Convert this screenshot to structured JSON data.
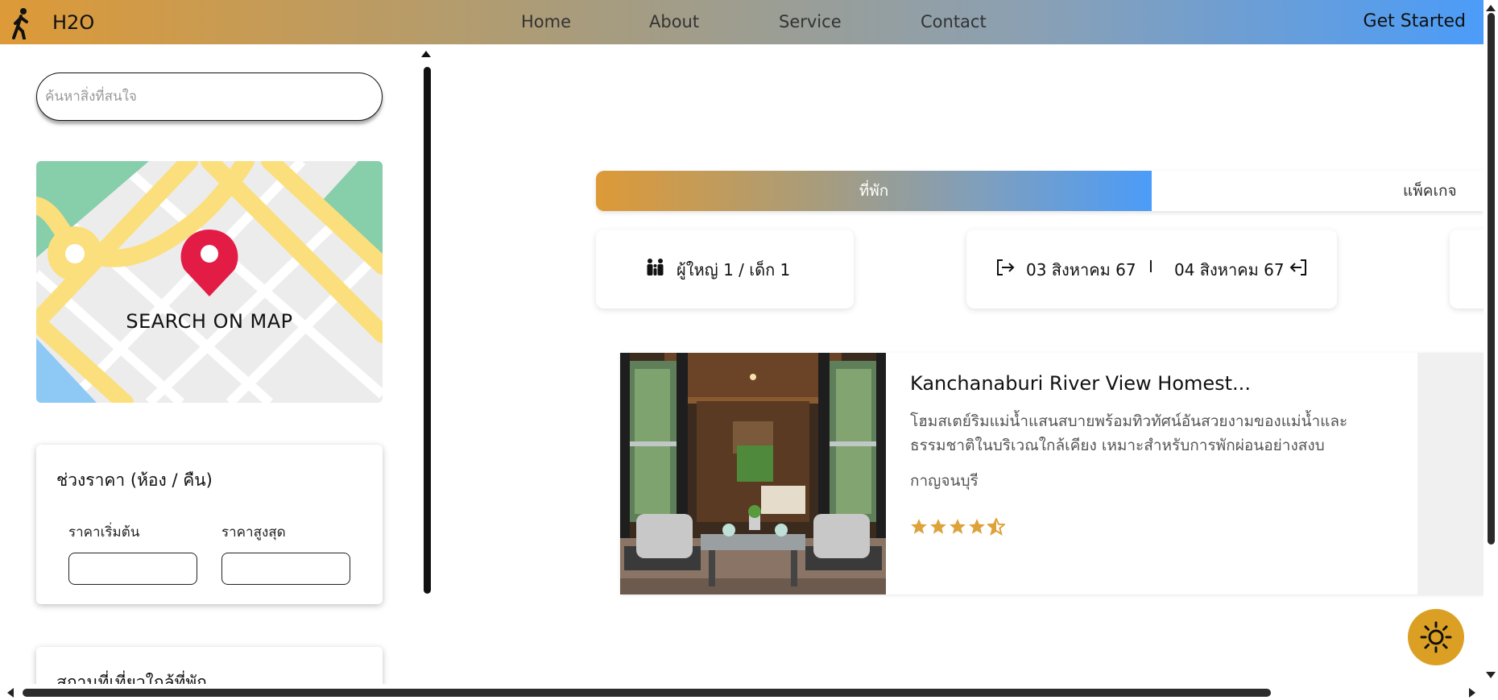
{
  "header": {
    "brand": "H2O",
    "nav": [
      "Home",
      "About",
      "Service",
      "Contact"
    ],
    "cta_label": "Get Started",
    "logo_icon": "walking-person-icon",
    "gradient_start": "#dd9a37",
    "gradient_end": "#4b9cf9"
  },
  "sidebar": {
    "search_placeholder": "ค้นหาสิ่งที่สนใจ",
    "map_label": "SEARCH ON MAP",
    "price": {
      "title": "ช่วงราคา (ห้อง / คืน)",
      "min_label": "ราคาเริ่มต้น",
      "max_label": "ราคาสูงสุด",
      "min_value": "",
      "max_value": ""
    },
    "nearby_title": "สถานที่เที่ยวใกล้ที่พัก"
  },
  "tabs": {
    "active": "ที่พัก",
    "inactive": "แพ็คเกจ"
  },
  "filters": {
    "guests_text": "ผู้ใหญ่ 1 /   เด็ก 1",
    "checkin": "03 สิงหาคม 67",
    "separator": "I",
    "checkout": "04 สิงหาคม 67"
  },
  "listing": {
    "title": "Kanchanaburi River View Homest...",
    "description": "โฮมสเตย์ริมแม่น้ำแสนสบายพร้อมทิวทัศน์อันสวยงามของแม่น้ำและธรรมชาติในบริเวณใกล้เคียง เหมาะสำหรับการพักผ่อนอย่างสงบ",
    "location": "กาญจนบุรี",
    "rating": 4.5,
    "rating_max": 5,
    "star_color": "#dda23a"
  },
  "theme_toggle_icon": "sun-icon",
  "theme_toggle_color": "#dba023"
}
